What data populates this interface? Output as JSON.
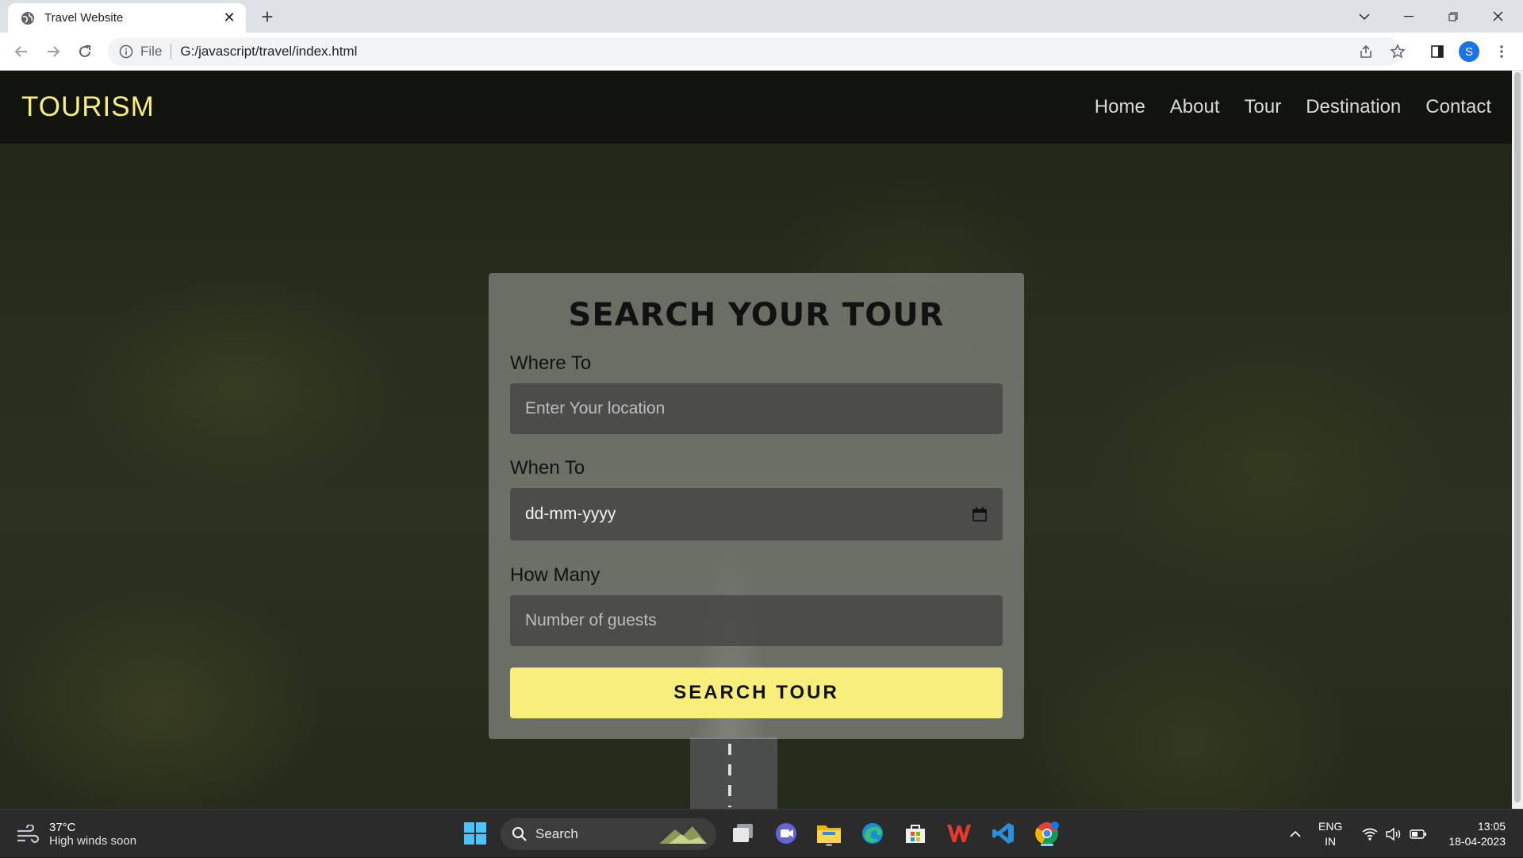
{
  "browser": {
    "tab_title": "Travel Website",
    "url_scheme": "File",
    "url": "G:/javascript/travel/index.html",
    "profile_initial": "S"
  },
  "site": {
    "logo": "TOURISM",
    "nav": [
      "Home",
      "About",
      "Tour",
      "Destination",
      "Contact"
    ]
  },
  "search_form": {
    "title": "SEARCH YOUR TOUR",
    "where_label": "Where To",
    "where_placeholder": "Enter Your location",
    "when_label": "When To",
    "when_value": "dd-mm-yyyy",
    "how_many_label": "How Many",
    "how_many_placeholder": "Number of guests",
    "submit_label": "SEARCH TOUR"
  },
  "taskbar": {
    "weather_temp": "37°C",
    "weather_condition": "High winds soon",
    "search_label": "Search",
    "lang_line1": "ENG",
    "lang_line2": "IN",
    "time": "13:05",
    "date": "18-04-2023"
  },
  "colors": {
    "accent_yellow": "#f8ee7c",
    "chrome_blue": "#1a73e8"
  }
}
